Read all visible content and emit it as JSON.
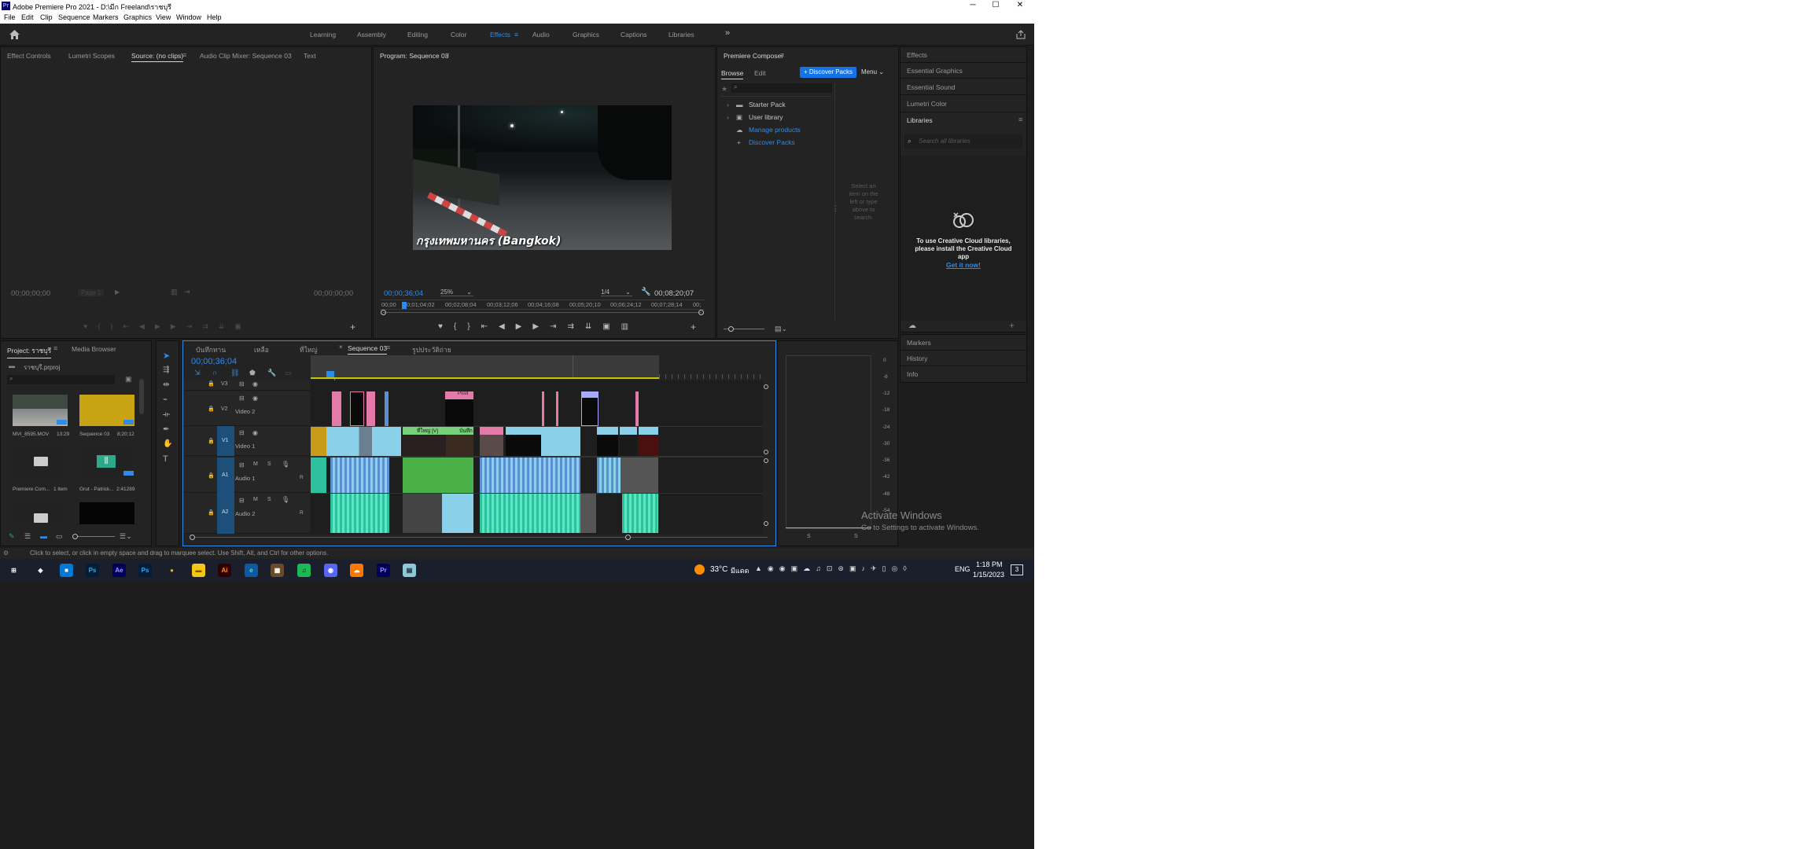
{
  "window": {
    "app_badge": "Pr",
    "title": "Adobe Premiere Pro 2021 - D:\\มีก Freeland\\ราชบุรี",
    "minimize": "─",
    "maximize": "☐",
    "close": "✕"
  },
  "menu": [
    "File",
    "Edit",
    "Clip",
    "Sequence",
    "Markers",
    "Graphics",
    "View",
    "Window",
    "Help"
  ],
  "workspaces": {
    "items": [
      "Learning",
      "Assembly",
      "Editing",
      "Color",
      "Effects",
      "Audio",
      "Graphics",
      "Captions",
      "Libraries"
    ],
    "active": "Effects",
    "overflow": "»"
  },
  "source_panel": {
    "tabs": [
      "Effect Controls",
      "Lumetri Scopes",
      "Source: (no clips)",
      "Audio Clip Mixer: Sequence 03",
      "Text"
    ],
    "active_tab": "Source: (no clips)",
    "timecode_left": "00;00;00;00",
    "page": "Page 1",
    "timecode_right": "00;00;00;00"
  },
  "program_panel": {
    "title": "Program: Sequence 03",
    "caption": "กรุงเทพมหานคร (Bangkok)",
    "timecode": "00;00;36;04",
    "zoom": "25%",
    "quality": "1/4",
    "duration": "00;08;20;07",
    "ruler": [
      "00;00",
      "00;01;04;02",
      "00;02;08;04",
      "00;03;12;06",
      "00;04;16;08",
      "00;05;20;10",
      "00;06;24;12",
      "00;07;28;14",
      "00;"
    ]
  },
  "composer": {
    "title": "Premiere Composer",
    "tabs": [
      "Browse",
      "Edit"
    ],
    "discover_button": "+ Discover Packs",
    "menu_button": "Menu",
    "items": [
      {
        "label": "Starter Pack",
        "link": false
      },
      {
        "label": "User library",
        "link": false
      },
      {
        "label": "Manage products",
        "link": true
      },
      {
        "label": "Discover Packs",
        "link": true
      }
    ],
    "hint": "Select an item on the left or type above to search."
  },
  "right_panels": {
    "top": [
      "Effects",
      "Essential Graphics",
      "Essential Sound",
      "Lumetri Color"
    ],
    "libraries_title": "Libraries",
    "search_placeholder": "Search all libraries",
    "cc_message": "To use Creative Cloud libraries, please install the Creative Cloud app",
    "cc_link": "Get it now!",
    "bottom": [
      "Markers",
      "History",
      "Info"
    ]
  },
  "project": {
    "tabs": [
      "Project: ราชบุรี",
      "Media Browser"
    ],
    "file": "ราชบุรี.prproj",
    "items": [
      {
        "name": "MVI_8595.MOV",
        "meta": "13:29"
      },
      {
        "name": "Sequence 03",
        "meta": "8;20;12"
      },
      {
        "name": "Premiere Com...",
        "meta": "1 item"
      },
      {
        "name": "Grut - Patrick...",
        "meta": "2:41289"
      },
      {
        "name": "",
        "meta": ""
      },
      {
        "name": "",
        "meta": ""
      }
    ]
  },
  "timeline": {
    "tabs": [
      "บันทึกทาน",
      "เหลือ",
      "ที่ใหญ่",
      "Sequence 03",
      "รูปประวัติถ่าย"
    ],
    "active_tab": "Sequence 03",
    "timecode": "00;00;36;04",
    "tracks": [
      {
        "id": "V3",
        "name": ""
      },
      {
        "id": "V2",
        "name": "Video 2"
      },
      {
        "id": "V1",
        "name": "Video 1"
      },
      {
        "id": "A1",
        "name": "Audio 1"
      },
      {
        "id": "A2",
        "name": "Audio 2"
      }
    ],
    "clip_labels": [
      "Posit",
      "ที่ใหญ่ [V]",
      "บันทึก"
    ]
  },
  "meter": {
    "db_labels": [
      "0",
      "-6",
      "-12",
      "-18",
      "-24",
      "-30",
      "-36",
      "-42",
      "-48",
      "-54"
    ],
    "solo": [
      "S",
      "S"
    ]
  },
  "status": "Click to select, or click in empty space and drag to marquee select. Use Shift, Alt, and Ctrl for other options.",
  "watermark": {
    "line1": "Activate Windows",
    "line2": "Go to Settings to activate Windows."
  },
  "taskbar": {
    "weather": "33°C",
    "weather_text": "มีแดด",
    "lang": "ENG",
    "time": "1:18 PM",
    "date": "1/15/2023",
    "notifications": "3",
    "apps": [
      {
        "name": "windows-start",
        "label": "⊞",
        "bg": "#1b1f2b",
        "fg": "#ffffff"
      },
      {
        "name": "widgets",
        "label": "◈",
        "bg": "#1b1f2b",
        "fg": "#ffffff"
      },
      {
        "name": "file-manager",
        "label": "■",
        "bg": "#0078d4",
        "fg": "#ffffff"
      },
      {
        "name": "photoshop",
        "label": "Ps",
        "bg": "#001e36",
        "fg": "#31a8ff"
      },
      {
        "name": "after-effects",
        "label": "Ae",
        "bg": "#00005b",
        "fg": "#9999ff"
      },
      {
        "name": "photoshop-2",
        "label": "Ps",
        "bg": "#001e36",
        "fg": "#31a8ff"
      },
      {
        "name": "chrome",
        "label": "●",
        "bg": "#1b1f2b",
        "fg": "#e8b00f"
      },
      {
        "name": "explorer",
        "label": "▬",
        "bg": "#f5c518",
        "fg": "#7a5b00"
      },
      {
        "name": "illustrator",
        "label": "Ai",
        "bg": "#330000",
        "fg": "#ff9a00"
      },
      {
        "name": "edge",
        "label": "e",
        "bg": "#0c59a4",
        "fg": "#5ee0a8"
      },
      {
        "name": "app-misc",
        "label": "▦",
        "bg": "#6a4a2a",
        "fg": "#ffffff"
      },
      {
        "name": "spotify",
        "label": "♫",
        "bg": "#1db954",
        "fg": "#000000"
      },
      {
        "name": "discord",
        "label": "◉",
        "bg": "#5865f2",
        "fg": "#ffffff"
      },
      {
        "name": "soundcloud",
        "label": "☁",
        "bg": "#ff7700",
        "fg": "#ffffff"
      },
      {
        "name": "premiere",
        "label": "Pr",
        "bg": "#00005b",
        "fg": "#9999ff"
      },
      {
        "name": "notes",
        "label": "▤",
        "bg": "#8ec8d8",
        "fg": "#1b1f2b"
      }
    ]
  }
}
